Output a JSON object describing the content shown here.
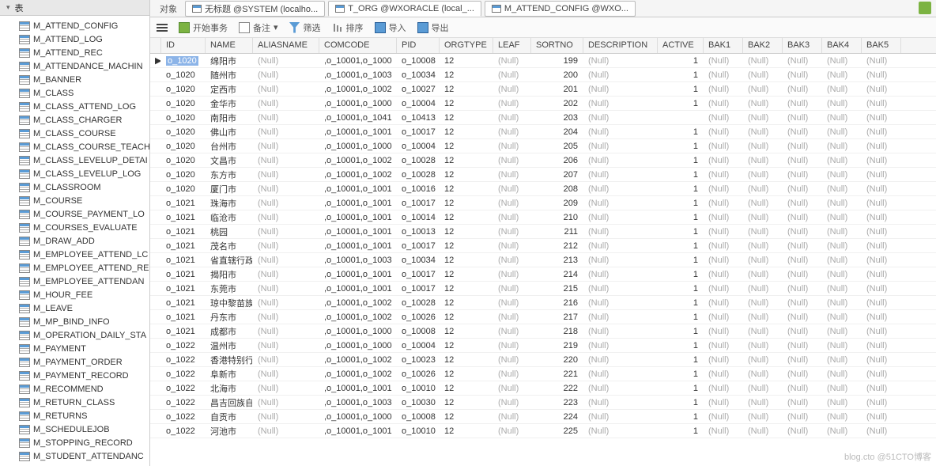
{
  "sidebar": {
    "title": "表",
    "items": [
      "M_ATTEND_CONFIG",
      "M_ATTEND_LOG",
      "M_ATTEND_REC",
      "M_ATTENDANCE_MACHIN",
      "M_BANNER",
      "M_CLASS",
      "M_CLASS_ATTEND_LOG",
      "M_CLASS_CHARGER",
      "M_CLASS_COURSE",
      "M_CLASS_COURSE_TEACH",
      "M_CLASS_LEVELUP_DETAI",
      "M_CLASS_LEVELUP_LOG",
      "M_CLASSROOM",
      "M_COURSE",
      "M_COURSE_PAYMENT_LO",
      "M_COURSES_EVALUATE",
      "M_DRAW_ADD",
      "M_EMPLOYEE_ATTEND_LC",
      "M_EMPLOYEE_ATTEND_RE",
      "M_EMPLOYEE_ATTENDAN",
      "M_HOUR_FEE",
      "M_LEAVE",
      "M_MP_BIND_INFO",
      "M_OPERATION_DAILY_STA",
      "M_PAYMENT",
      "M_PAYMENT_ORDER",
      "M_PAYMENT_RECORD",
      "M_RECOMMEND",
      "M_RETURN_CLASS",
      "M_RETURNS",
      "M_SCHEDULEJOB",
      "M_STOPPING_RECORD",
      "M_STUDENT_ATTENDANC"
    ]
  },
  "tabs": {
    "label": "对象",
    "list": [
      {
        "label": "无标题 @SYSTEM (localho...",
        "icon": "query"
      },
      {
        "label": "T_ORG @WXORACLE (local_...",
        "icon": "table",
        "active": true
      },
      {
        "label": "M_ATTEND_CONFIG @WXO...",
        "icon": "table"
      }
    ]
  },
  "toolbar": {
    "begin": "开始事务",
    "note": "备注",
    "filter": "筛选",
    "sort": "排序",
    "import": "导入",
    "export": "导出"
  },
  "grid": {
    "columns": [
      "ID",
      "NAME",
      "ALIASNAME",
      "COMCODE",
      "PID",
      "ORGTYPE",
      "LEAF",
      "SORTNO",
      "DESCRIPTION",
      "ACTIVE",
      "BAK1",
      "BAK2",
      "BAK3",
      "BAK4",
      "BAK5"
    ],
    "null": "(Null)",
    "rows": [
      {
        "id": "o_1020",
        "name": "绵阳市",
        "comcode": ",o_10001,o_1000",
        "pid": "o_10008",
        "orgtype": "12",
        "sortno": "199",
        "active": "1",
        "selected": true
      },
      {
        "id": "o_1020",
        "name": "随州市",
        "comcode": ",o_10001,o_1003",
        "pid": "o_10034",
        "orgtype": "12",
        "sortno": "200",
        "active": "1"
      },
      {
        "id": "o_1020",
        "name": "定西市",
        "comcode": ",o_10001,o_1002",
        "pid": "o_10027",
        "orgtype": "12",
        "sortno": "201",
        "active": "1"
      },
      {
        "id": "o_1020",
        "name": "金华市",
        "comcode": ",o_10001,o_1000",
        "pid": "o_10004",
        "orgtype": "12",
        "sortno": "202",
        "active": "1"
      },
      {
        "id": "o_1020",
        "name": "南阳市",
        "comcode": ",o_10001,o_1041",
        "pid": "o_10413",
        "orgtype": "12",
        "sortno": "203",
        "active": ""
      },
      {
        "id": "o_1020",
        "name": "佛山市",
        "comcode": ",o_10001,o_1001",
        "pid": "o_10017",
        "orgtype": "12",
        "sortno": "204",
        "active": "1"
      },
      {
        "id": "o_1020",
        "name": "台州市",
        "comcode": ",o_10001,o_1000",
        "pid": "o_10004",
        "orgtype": "12",
        "sortno": "205",
        "active": "1"
      },
      {
        "id": "o_1020",
        "name": "文昌市",
        "comcode": ",o_10001,o_1002",
        "pid": "o_10028",
        "orgtype": "12",
        "sortno": "206",
        "active": "1"
      },
      {
        "id": "o_1020",
        "name": "东方市",
        "comcode": ",o_10001,o_1002",
        "pid": "o_10028",
        "orgtype": "12",
        "sortno": "207",
        "active": "1"
      },
      {
        "id": "o_1020",
        "name": "厦门市",
        "comcode": ",o_10001,o_1001",
        "pid": "o_10016",
        "orgtype": "12",
        "sortno": "208",
        "active": "1"
      },
      {
        "id": "o_1021",
        "name": "珠海市",
        "comcode": ",o_10001,o_1001",
        "pid": "o_10017",
        "orgtype": "12",
        "sortno": "209",
        "active": "1"
      },
      {
        "id": "o_1021",
        "name": "临沧市",
        "comcode": ",o_10001,o_1001",
        "pid": "o_10014",
        "orgtype": "12",
        "sortno": "210",
        "active": "1"
      },
      {
        "id": "o_1021",
        "name": "桃园",
        "comcode": ",o_10001,o_1001",
        "pid": "o_10013",
        "orgtype": "12",
        "sortno": "211",
        "active": "1"
      },
      {
        "id": "o_1021",
        "name": "茂名市",
        "comcode": ",o_10001,o_1001",
        "pid": "o_10017",
        "orgtype": "12",
        "sortno": "212",
        "active": "1"
      },
      {
        "id": "o_1021",
        "name": "省直辖行政",
        "comcode": ",o_10001,o_1003",
        "pid": "o_10034",
        "orgtype": "12",
        "sortno": "213",
        "active": "1"
      },
      {
        "id": "o_1021",
        "name": "揭阳市",
        "comcode": ",o_10001,o_1001",
        "pid": "o_10017",
        "orgtype": "12",
        "sortno": "214",
        "active": "1"
      },
      {
        "id": "o_1021",
        "name": "东莞市",
        "comcode": ",o_10001,o_1001",
        "pid": "o_10017",
        "orgtype": "12",
        "sortno": "215",
        "active": "1"
      },
      {
        "id": "o_1021",
        "name": "琼中黎苗族",
        "comcode": ",o_10001,o_1002",
        "pid": "o_10028",
        "orgtype": "12",
        "sortno": "216",
        "active": "1"
      },
      {
        "id": "o_1021",
        "name": "丹东市",
        "comcode": ",o_10001,o_1002",
        "pid": "o_10026",
        "orgtype": "12",
        "sortno": "217",
        "active": "1"
      },
      {
        "id": "o_1021",
        "name": "成都市",
        "comcode": ",o_10001,o_1000",
        "pid": "o_10008",
        "orgtype": "12",
        "sortno": "218",
        "active": "1"
      },
      {
        "id": "o_1022",
        "name": "温州市",
        "comcode": ",o_10001,o_1000",
        "pid": "o_10004",
        "orgtype": "12",
        "sortno": "219",
        "active": "1"
      },
      {
        "id": "o_1022",
        "name": "香港特别行",
        "comcode": ",o_10001,o_1002",
        "pid": "o_10023",
        "orgtype": "12",
        "sortno": "220",
        "active": "1"
      },
      {
        "id": "o_1022",
        "name": "阜新市",
        "comcode": ",o_10001,o_1002",
        "pid": "o_10026",
        "orgtype": "12",
        "sortno": "221",
        "active": "1"
      },
      {
        "id": "o_1022",
        "name": "北海市",
        "comcode": ",o_10001,o_1001",
        "pid": "o_10010",
        "orgtype": "12",
        "sortno": "222",
        "active": "1"
      },
      {
        "id": "o_1022",
        "name": "昌吉回族自",
        "comcode": ",o_10001,o_1003",
        "pid": "o_10030",
        "orgtype": "12",
        "sortno": "223",
        "active": "1"
      },
      {
        "id": "o_1022",
        "name": "自贡市",
        "comcode": ",o_10001,o_1000",
        "pid": "o_10008",
        "orgtype": "12",
        "sortno": "224",
        "active": "1"
      },
      {
        "id": "o_1022",
        "name": "河池市",
        "comcode": ",o_10001,o_1001",
        "pid": "o_10010",
        "orgtype": "12",
        "sortno": "225",
        "active": "1"
      }
    ]
  },
  "watermark": "blog.cto @51CTO博客"
}
